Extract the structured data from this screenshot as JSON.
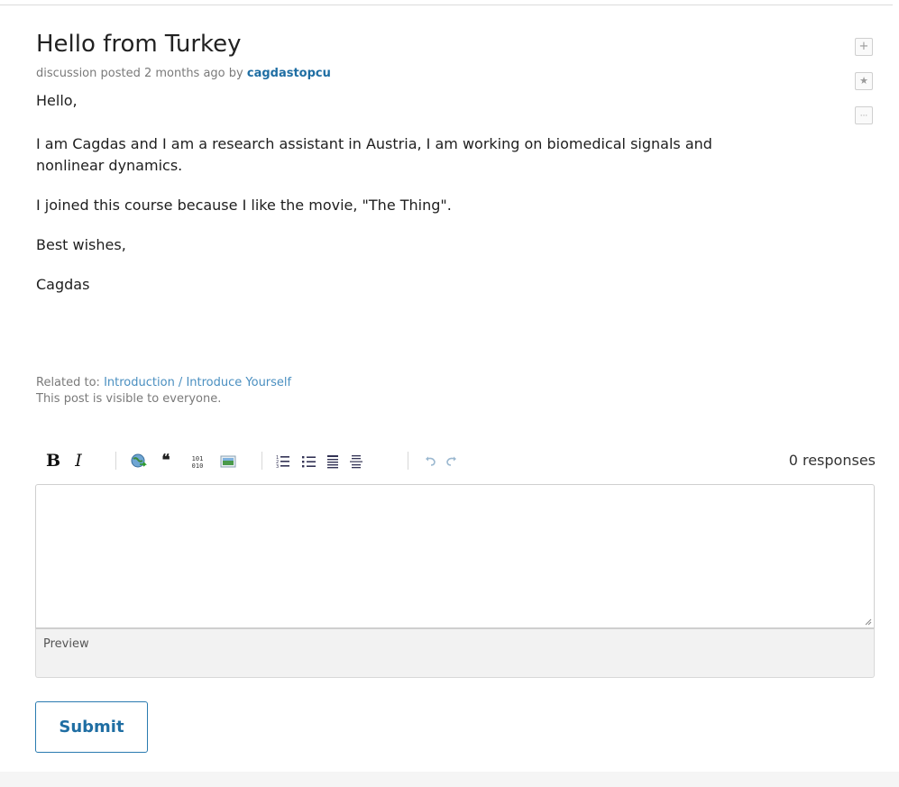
{
  "post": {
    "title": "Hello from Turkey",
    "meta_prefix": "discussion posted 2 months ago by",
    "author": "cagdastopcu",
    "body": [
      "Hello,",
      "I am Cagdas and I am a research assistant in Austria, I am working on biomedical signals and nonlinear dynamics.",
      "I joined this course because I like the movie, \"The Thing\".",
      "Best wishes,",
      "Cagdas"
    ],
    "related_prefix": "Related to:",
    "related_link": "Introduction / Introduce Yourself",
    "visibility": "This post is visible to everyone."
  },
  "side_actions": [
    {
      "name": "follow-button",
      "icon": "plus-icon",
      "glyph": "+"
    },
    {
      "name": "star-button",
      "icon": "star-icon",
      "glyph": "★"
    },
    {
      "name": "more-button",
      "icon": "ellipsis-icon",
      "glyph": "···"
    }
  ],
  "toolbar": {
    "bold": "B",
    "italic": "I",
    "quote": "❝",
    "code": "101\n010",
    "responses": "0 responses"
  },
  "editor": {
    "value": "",
    "preview_label": "Preview"
  },
  "submit_label": "Submit",
  "colors": {
    "accent": "#1f6ea3",
    "link": "#4a8fc0",
    "meta_text": "#7a7a7a"
  }
}
